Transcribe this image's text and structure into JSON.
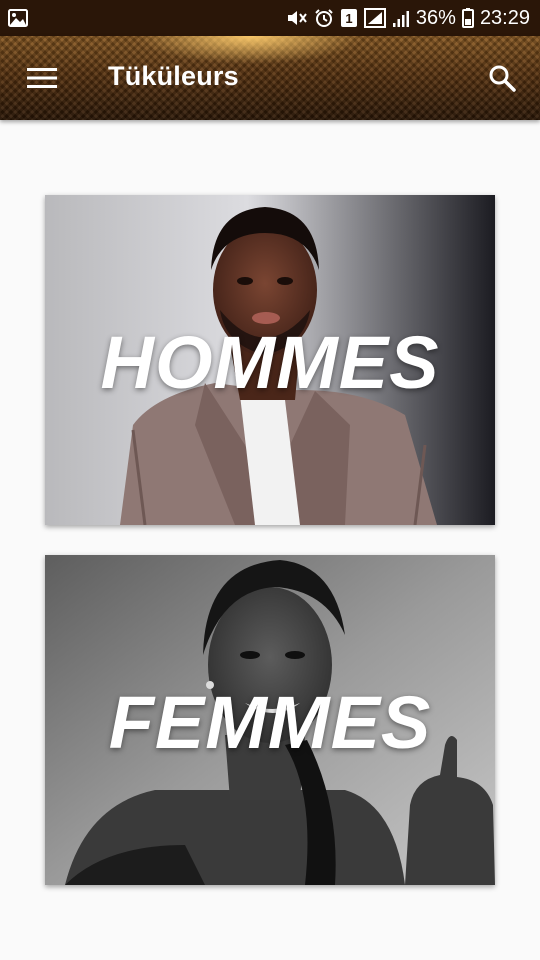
{
  "status_bar": {
    "icons": [
      "image-icon",
      "mute-icon",
      "alarm-icon",
      "sim-1-icon",
      "signal-icon",
      "signal-bars-icon",
      "battery-icon"
    ],
    "sim_badge": "1",
    "battery_percent": "36%",
    "time": "23:29"
  },
  "app_bar": {
    "title": "Tüküleurs",
    "menu_icon": "hamburger-menu-icon",
    "search_icon": "search-icon"
  },
  "categories": [
    {
      "label": "HOMMES"
    },
    {
      "label": "FEMMES"
    }
  ],
  "colors": {
    "status_bar_bg": "#2a1608",
    "app_bar_bg": "#5c3511",
    "page_bg": "#fafafa",
    "label_text": "#ffffff"
  }
}
